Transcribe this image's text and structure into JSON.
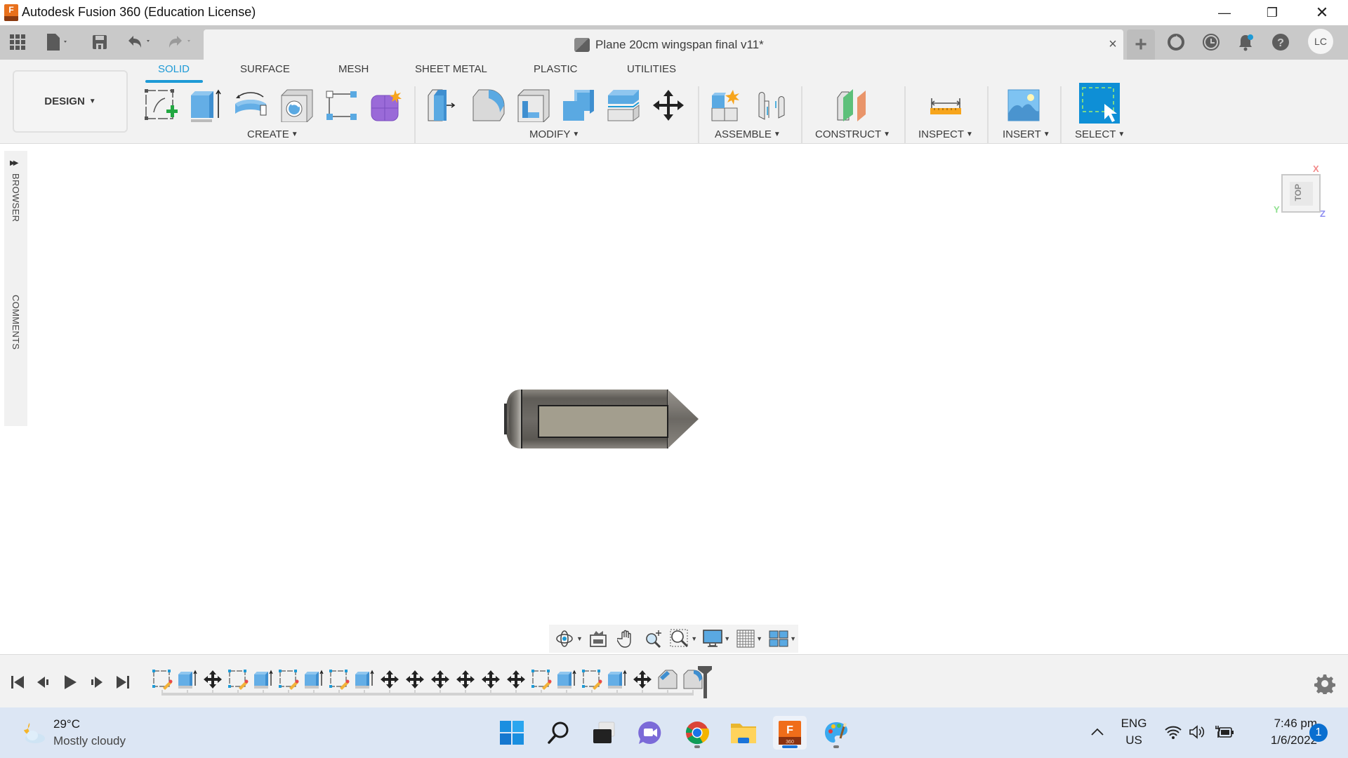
{
  "window": {
    "title": "Autodesk Fusion 360 (Education License)",
    "app_icon_letter": "F",
    "controls": {
      "minimize": "—",
      "restore": "❐",
      "close": "✕"
    }
  },
  "tabbar": {
    "quick_access": [
      "data-panel-icon",
      "file-icon",
      "save-icon",
      "undo-icon",
      "redo-icon"
    ],
    "document_title": "Plane 20cm wingspan final v11*",
    "close_symbol": "×",
    "new_tab_symbol": "+",
    "right_icons": [
      "extensions-icon",
      "job-status-icon",
      "notifications-icon",
      "help-icon"
    ],
    "user_initials": "LC"
  },
  "ribbon": {
    "workspace": "DESIGN",
    "tabs": [
      {
        "label": "SOLID",
        "active": true
      },
      {
        "label": "SURFACE",
        "active": false
      },
      {
        "label": "MESH",
        "active": false
      },
      {
        "label": "SHEET METAL",
        "active": false
      },
      {
        "label": "PLASTIC",
        "active": false
      },
      {
        "label": "UTILITIES",
        "active": false
      }
    ],
    "groups": [
      {
        "label": "CREATE",
        "tools": [
          "create-sketch",
          "extrude",
          "revolve",
          "hole",
          "pattern",
          "create-form"
        ]
      },
      {
        "label": "MODIFY",
        "tools": [
          "press-pull",
          "fillet",
          "shell",
          "combine",
          "offset-face",
          "move-copy"
        ]
      },
      {
        "label": "ASSEMBLE",
        "tools": [
          "new-component",
          "joint"
        ]
      },
      {
        "label": "CONSTRUCT",
        "tools": [
          "offset-plane"
        ]
      },
      {
        "label": "INSPECT",
        "tools": [
          "measure"
        ]
      },
      {
        "label": "INSERT",
        "tools": [
          "insert-image"
        ]
      },
      {
        "label": "SELECT",
        "tools": [
          "select"
        ]
      }
    ],
    "caret": "▼"
  },
  "side_panel": {
    "browser_label": "BROWSER",
    "comments_label": "COMMENTS",
    "expand_symbol": "▶▶"
  },
  "viewcube": {
    "face_label": "TOP",
    "axes": {
      "x": "X",
      "y": "Y",
      "z": "Z"
    }
  },
  "nav_toolbar": [
    "orbit",
    "look-at",
    "pan",
    "zoom",
    "fit",
    "display-settings",
    "grid-snaps",
    "viewports"
  ],
  "timeline": {
    "controls": [
      "first",
      "previous",
      "play",
      "next",
      "last"
    ],
    "features": [
      "sketch",
      "extrude",
      "move",
      "sketch",
      "extrude",
      "sketch",
      "extrude",
      "sketch",
      "extrude",
      "move",
      "move",
      "move",
      "move",
      "move",
      "move",
      "sketch",
      "extrude",
      "sketch",
      "extrude",
      "move",
      "chamfer",
      "fillet"
    ]
  },
  "taskbar": {
    "weather": {
      "temperature": "29°C",
      "condition": "Mostly cloudy"
    },
    "apps": [
      {
        "name": "start",
        "running": false
      },
      {
        "name": "search",
        "running": false
      },
      {
        "name": "task-view",
        "running": false
      },
      {
        "name": "teams-chat",
        "running": false
      },
      {
        "name": "chrome",
        "running": true
      },
      {
        "name": "file-explorer",
        "running": false
      },
      {
        "name": "fusion-360",
        "running": true,
        "active": true
      },
      {
        "name": "paint",
        "running": true
      }
    ],
    "tray": {
      "language_line1": "ENG",
      "language_line2": "US",
      "time": "7:46 pm",
      "date": "1/6/2022",
      "notification_count": "1",
      "overflow_symbol": "^"
    }
  },
  "colors": {
    "accent": "#1d9ad6",
    "fusion_orange": "#e8701c",
    "tool_blue": "#5aa9e2",
    "body_grey": "#6e6b66",
    "body_face": "#a39e8e"
  }
}
